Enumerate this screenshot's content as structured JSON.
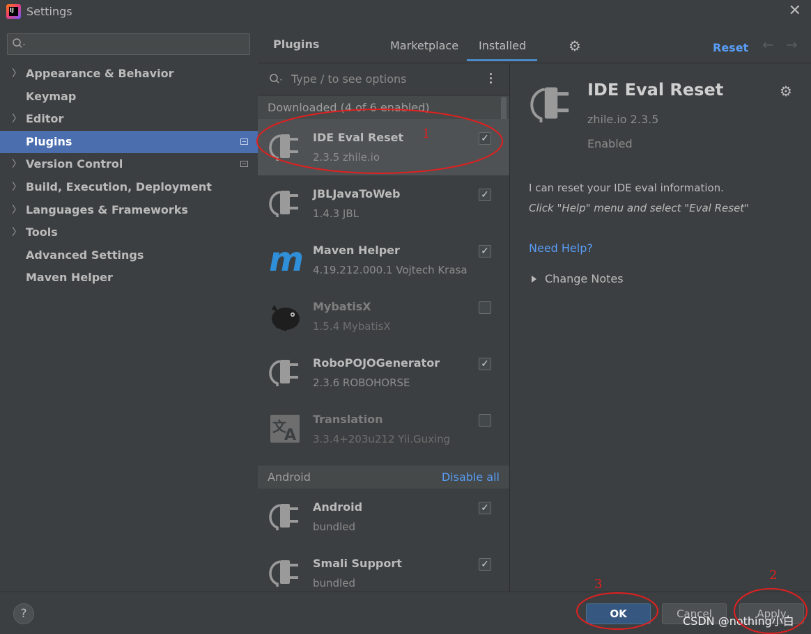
{
  "window": {
    "title": "Settings"
  },
  "sidebar": {
    "search_placeholder": "",
    "items": [
      {
        "label": "Appearance & Behavior",
        "expandable": true
      },
      {
        "label": "Keymap",
        "expandable": false
      },
      {
        "label": "Editor",
        "expandable": true
      },
      {
        "label": "Plugins",
        "expandable": false,
        "selected": true
      },
      {
        "label": "Version Control",
        "expandable": true
      },
      {
        "label": "Build, Execution, Deployment",
        "expandable": true
      },
      {
        "label": "Languages & Frameworks",
        "expandable": true
      },
      {
        "label": "Tools",
        "expandable": true
      },
      {
        "label": "Advanced Settings",
        "expandable": false
      },
      {
        "label": "Maven Helper",
        "expandable": false
      }
    ]
  },
  "plugins": {
    "title": "Plugins",
    "tabs": [
      "Marketplace",
      "Installed"
    ],
    "active_tab": "Installed",
    "reset_label": "Reset",
    "search_placeholder": "Type / to see options",
    "downloaded_header": "Downloaded (4 of 6 enabled)",
    "android_header": "Android",
    "disable_all_label": "Disable all",
    "items": [
      {
        "name": "IDE Eval Reset",
        "meta": "2.3.5  zhile.io",
        "checked": true,
        "icon": "plug-icon"
      },
      {
        "name": "JBLJavaToWeb",
        "meta": "1.4.3  JBL",
        "checked": true,
        "icon": "plug-icon"
      },
      {
        "name": "Maven Helper",
        "meta": "4.19.212.000.1  Vojtech Krasa",
        "checked": true,
        "icon": "maven-m-icon"
      },
      {
        "name": "MybatisX",
        "meta": "1.5.4  MybatisX",
        "checked": false,
        "icon": "bird-icon"
      },
      {
        "name": "RoboPOJOGenerator",
        "meta": "2.3.6  ROBOHORSE",
        "checked": true,
        "icon": "plug-icon"
      },
      {
        "name": "Translation",
        "meta": "3.3.4+203u212  Yii.Guxing",
        "checked": false,
        "icon": "translate-icon"
      }
    ],
    "android_items": [
      {
        "name": "Android",
        "meta": "bundled",
        "checked": true,
        "icon": "plug-icon"
      },
      {
        "name": "Smali Support",
        "meta": "bundled",
        "checked": true,
        "icon": "plug-icon"
      }
    ]
  },
  "detail": {
    "name": "IDE Eval Reset",
    "version_line": "zhile.io   2.3.5",
    "status": "Enabled",
    "description": "I can reset your IDE eval information.",
    "hint": "Click \"Help\" menu and select \"Eval Reset\"",
    "help_link": "Need Help?",
    "change_notes": "Change Notes"
  },
  "footer": {
    "help": "?",
    "ok": "OK",
    "cancel": "Cancel",
    "apply": "Apply",
    "watermark": "CSDN @nothing小白"
  },
  "annotations": [
    "1",
    "2",
    "3"
  ],
  "colors": {
    "accent": "#4b6eaf",
    "link": "#589df6",
    "background": "#3c3f41",
    "annotation": "#e02020"
  }
}
